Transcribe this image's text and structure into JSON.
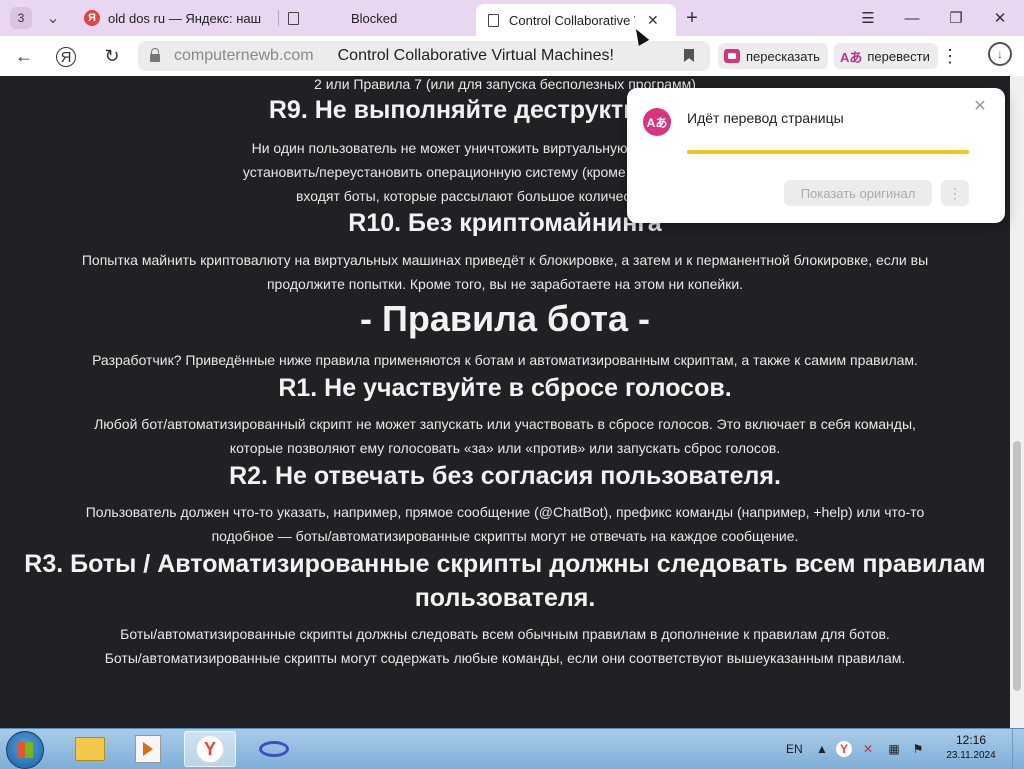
{
  "tabs": {
    "counter": "3",
    "items": [
      {
        "label": "old dos ru — Яндекс: наш",
        "icon": "yandex-icon"
      },
      {
        "label": "Blocked",
        "icon": "document-icon"
      },
      {
        "label": "Control Collaborative V",
        "icon": "document-icon",
        "active": true
      }
    ]
  },
  "toolbar": {
    "domain": "computernewb.com",
    "page_title": "Control Collaborative Virtual Machines!",
    "retell_label": "пересказать",
    "translate_label": "перевести"
  },
  "article": {
    "top_partial": "2 или Правила 7 (или для запуска бесполезных программ)",
    "r9_title": "R9. Не выполняйте деструктивных де",
    "r9_text1": "Ни один пользователь не может уничтожить виртуальную машину (постоянно",
    "r9_text2": "установить/переустановить операционную систему (кроме как на VM7 или VM8)",
    "r9_text3": "входят боты, которые рассылают большое количество команд с",
    "r10_title": "R10. Без криптомайнинга",
    "r10_text1": "Попытка майнить криптовалюту на виртуальных машинах приведёт к блокировке, а затем и к перманентной блокировке, если вы",
    "r10_text2": "продолжите попытки. Кроме того, вы не заработаете на этом ни копейки.",
    "bot_rules_title": "- Правила бота -",
    "bot_rules_intro": "Разработчик? Приведённые ниже правила применяются к ботам и автоматизированным скриптам, а также к самим правилам.",
    "r1_title": "R1. Не участвуйте в сбросе голосов.",
    "r1_text1": "Любой бот/автоматизированный скрипт не может запускать или участвовать в сбросе голосов. Это включает в себя команды,",
    "r1_text2": "которые позволяют ему голосовать «за» или «против» или запускать сброс голосов.",
    "r2_title": "R2. Не отвечать без согласия пользователя.",
    "r2_text1": "Пользователь должен что-то указать, например, прямое сообщение (@ChatBot), префикс команды (например, +help) или что-то",
    "r2_text2": "подобное — боты/автоматизированные скрипты могут не отвечать на каждое сообщение.",
    "r3_title1": "R3. Боты / Автоматизированные скрипты должны следовать всем правилам",
    "r3_title2": "пользователя.",
    "r3_text1": "Боты/автоматизированные скрипты должны следовать всем обычным правилам в дополнение к правилам для ботов.",
    "r3_text2": "Боты/автоматизированные скрипты могут содержать любые команды, если они соответствуют вышеуказанным правилам."
  },
  "translate_popup": {
    "title": "Идёт перевод страницы",
    "show_original": "Показать оригинал",
    "more": "⋮",
    "progress": 1.0
  },
  "taskbar": {
    "lang": "EN",
    "time": "12:16",
    "date": "23.11.2024"
  }
}
